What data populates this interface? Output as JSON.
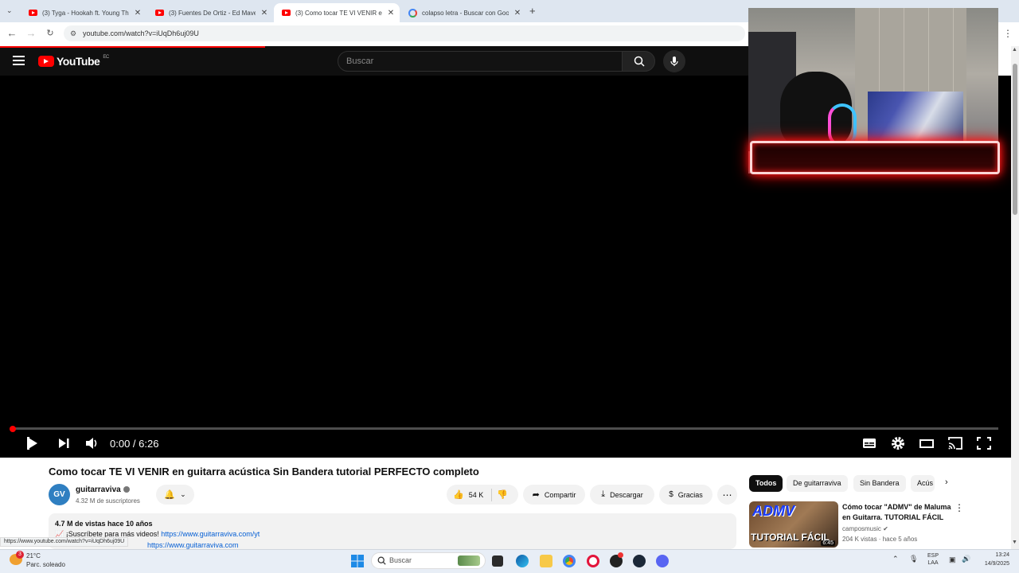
{
  "browser": {
    "tabs": [
      {
        "title": "(3) Tyga - Hookah ft. Young Thu",
        "favicon": "youtube"
      },
      {
        "title": "(3) Fuentes De Ortiz - Ed Maver",
        "favicon": "youtube"
      },
      {
        "title": "(3) Como tocar TE VI VENIR en",
        "favicon": "youtube",
        "active": true
      },
      {
        "title": "colapso letra - Buscar con Goo",
        "favicon": "google"
      }
    ],
    "url": "youtube.com/watch?v=iUqDh6uj09U",
    "status_url": "https://www.youtube.com/watch?v=iUqDh6uj09U"
  },
  "youtube": {
    "logo_text": "YouTube",
    "region": "EC",
    "search_placeholder": "Buscar",
    "player": {
      "current_time": "0:00",
      "duration": "6:26",
      "time_display": "0:00 / 6:26",
      "progress": 0.0
    },
    "video": {
      "title": "Como tocar TE VI VENIR en guitarra acústica Sin Bandera tutorial PERFECTO completo",
      "channel": "guitarraviva",
      "channel_initials": "GV",
      "subscribers": "4.32 M de suscriptores",
      "likes": "54 K",
      "share_label": "Compartir",
      "download_label": "Descargar",
      "thanks_label": "Gracias",
      "views_line": "4.7 M de vistas  hace 10 años",
      "desc_line1_prefix": "📈 ¡Suscríbete para más videos! ",
      "desc_line1_link": "https://www.guitarraviva.com/yt",
      "desc_line2_link": "https://www.guitarraviva.com"
    },
    "chips": [
      "Todos",
      "De guitarraviva",
      "Sin Bandera",
      "Acús"
    ],
    "recommended": {
      "title": "Cómo tocar \"ADMV\" de Maluma en Guitarra. TUTORIAL FÁCIL",
      "channel": "camposmusic",
      "meta": "204 K vistas · hace 5 años",
      "duration": "6:45",
      "thumb_text1": "ADMV",
      "thumb_text2": "TUTORIAL FÁCIL"
    }
  },
  "taskbar": {
    "weather_temp": "21°C",
    "weather_desc": "Parc. soleado",
    "weather_badge": "3",
    "search_placeholder": "Buscar",
    "lang_line1": "ESP",
    "lang_line2": "LAA",
    "time": "13:24",
    "date": "14/9/2025"
  }
}
